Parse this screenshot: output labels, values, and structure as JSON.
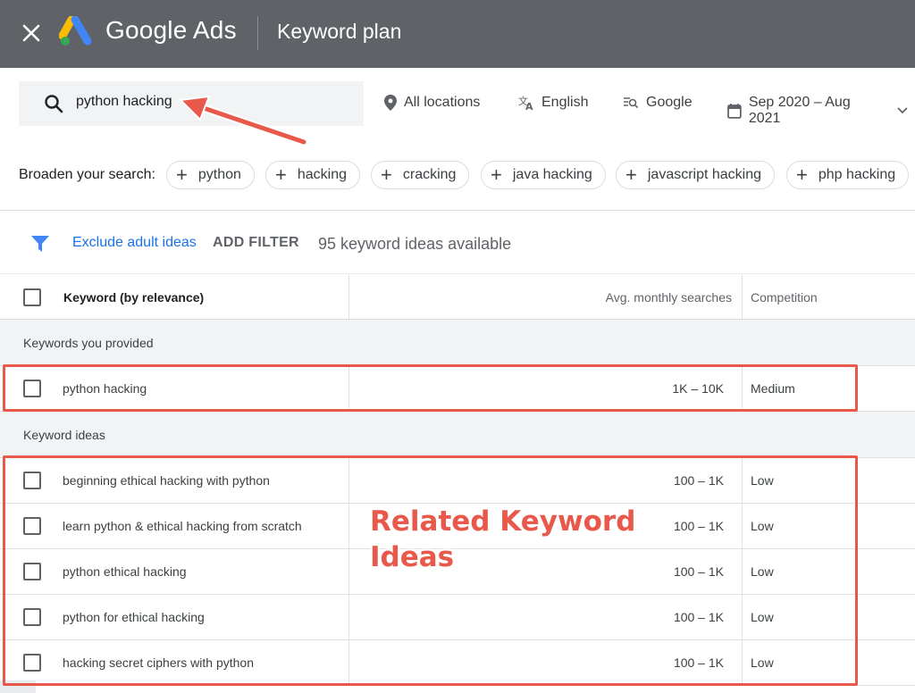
{
  "topbar": {
    "brand": "Google Ads",
    "title": "Keyword plan"
  },
  "search": {
    "value": "python hacking",
    "placeholder": ""
  },
  "targeting": {
    "location": "All locations",
    "language": "English",
    "network": "Google",
    "date_range": "Sep 2020 – Aug 2021"
  },
  "broaden": {
    "label": "Broaden your search:",
    "chips": [
      "python",
      "hacking",
      "cracking",
      "java hacking",
      "javascript hacking",
      "php hacking"
    ]
  },
  "filters": {
    "exclude_adult": "Exclude adult ideas",
    "add_filter": "ADD FILTER",
    "ideas_count": "95 keyword ideas available"
  },
  "table": {
    "headers": {
      "keyword": "Keyword (by relevance)",
      "searches": "Avg. monthly searches",
      "competition": "Competition"
    },
    "provided_section": "Keywords you provided",
    "provided": [
      {
        "keyword": "python hacking",
        "searches": "1K – 10K",
        "competition": "Medium"
      }
    ],
    "ideas_section": "Keyword ideas",
    "ideas": [
      {
        "keyword": "beginning ethical hacking with python",
        "searches": "100 – 1K",
        "competition": "Low"
      },
      {
        "keyword": "learn python & ethical hacking from scratch",
        "searches": "100 – 1K",
        "competition": "Low"
      },
      {
        "keyword": "python ethical hacking",
        "searches": "100 – 1K",
        "competition": "Low"
      },
      {
        "keyword": "python for ethical hacking",
        "searches": "100 – 1K",
        "competition": "Low"
      },
      {
        "keyword": "hacking secret ciphers with python",
        "searches": "100 – 1K",
        "competition": "Low"
      }
    ]
  },
  "annotation": {
    "line1": "Related Keyword",
    "line2": "Ideas",
    "color": "#e8594b"
  },
  "colors": {
    "topbar": "#5f6368",
    "link": "#1a73e8",
    "funnel": "#4285f4"
  }
}
